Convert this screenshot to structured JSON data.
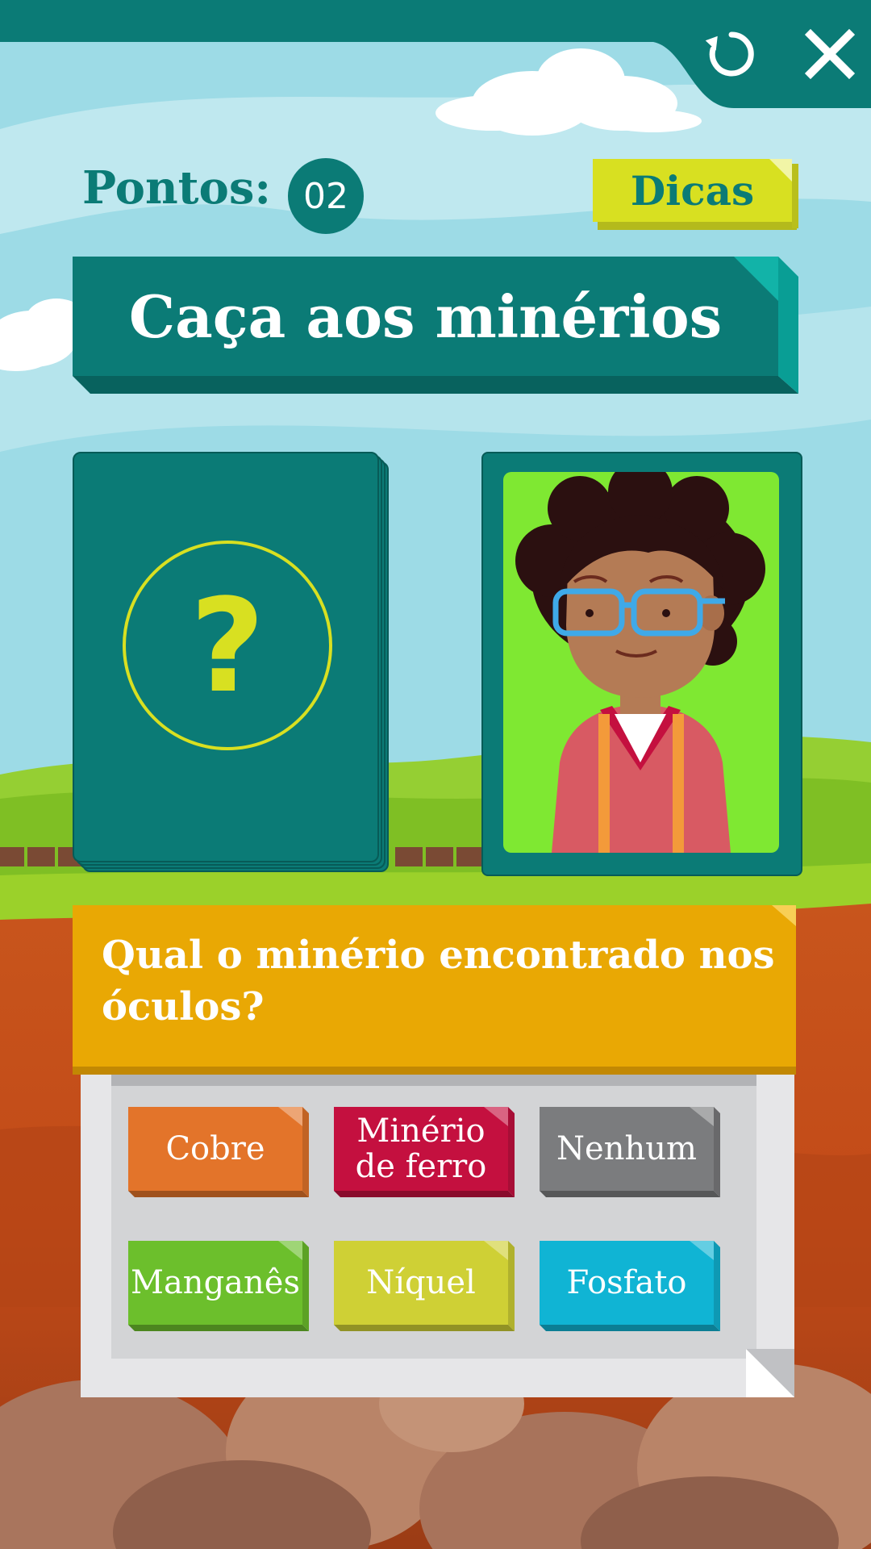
{
  "header": {
    "restart_icon": "restart-icon",
    "close_icon": "close-icon"
  },
  "score": {
    "label": "Pontos:",
    "value": "02"
  },
  "hints": {
    "label": "Dicas"
  },
  "game": {
    "title": "Caça aos minérios"
  },
  "deck": {
    "symbol": "?"
  },
  "question": {
    "text": "Qual o minério encontrado nos óculos?"
  },
  "answers": [
    {
      "label": "Cobre",
      "color": "#e3742a"
    },
    {
      "label": "Minério de ferro",
      "color": "#c4103f"
    },
    {
      "label": "Nenhum",
      "color": "#7b7c7e"
    },
    {
      "label": "Manganês",
      "color": "#6cbf2c"
    },
    {
      "label": "Níquel",
      "color": "#cfd035"
    },
    {
      "label": "Fosfato",
      "color": "#10b4d4"
    }
  ],
  "colors": {
    "primary_teal": "#0b7b76",
    "accent_yellow": "#d8e021",
    "question_orange": "#e9a804",
    "card_green": "#7fe832"
  }
}
